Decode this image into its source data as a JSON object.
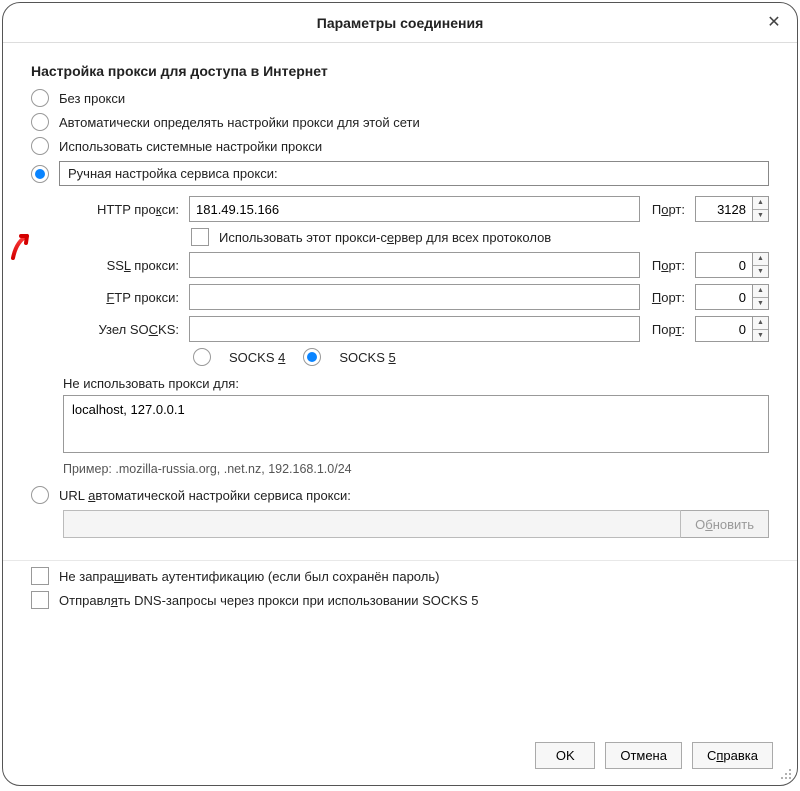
{
  "dialog": {
    "title": "Параметры соединения",
    "section_title": "Настройка прокси для доступа в Интернет",
    "options": {
      "no_proxy": "Без прокси",
      "auto_detect": "Автоматически определять настройки прокси для этой сети",
      "system": "Использовать системные настройки прокси",
      "manual": "Ручная настройка сервиса прокси:",
      "auto_url": "URL автоматической настройки сервиса прокси:"
    },
    "proxy": {
      "http_label": "HTTP прокси:",
      "http_host": "181.49.15.166",
      "http_port": "3128",
      "use_for_all": "Использовать этот прокси-сервер для всех протоколов",
      "ssl_label": "SSL прокси:",
      "ssl_host": "",
      "ssl_port": "0",
      "ftp_label": "FTP прокси:",
      "ftp_host": "",
      "ftp_port": "0",
      "socks_label": "Узел SOCKS:",
      "socks_host": "",
      "socks_port": "0",
      "port_label": "Порт:",
      "port_label_u": "Порт:",
      "socks4": "SOCKS 4",
      "socks5": "SOCKS 5"
    },
    "noproxy": {
      "label": "Не использовать прокси для:",
      "value": "localhost, 127.0.0.1",
      "example": "Пример: .mozilla-russia.org, .net.nz, 192.168.1.0/24"
    },
    "reload_btn": "Обновить",
    "checks": {
      "no_auth": "Не запрашивать аутентификацию (если был сохранён пароль)",
      "dns_socks5": "Отправлять DNS-запросы через прокси при использовании SOCKS 5"
    },
    "buttons": {
      "ok": "OK",
      "cancel": "Отмена",
      "help": "Справка"
    }
  }
}
